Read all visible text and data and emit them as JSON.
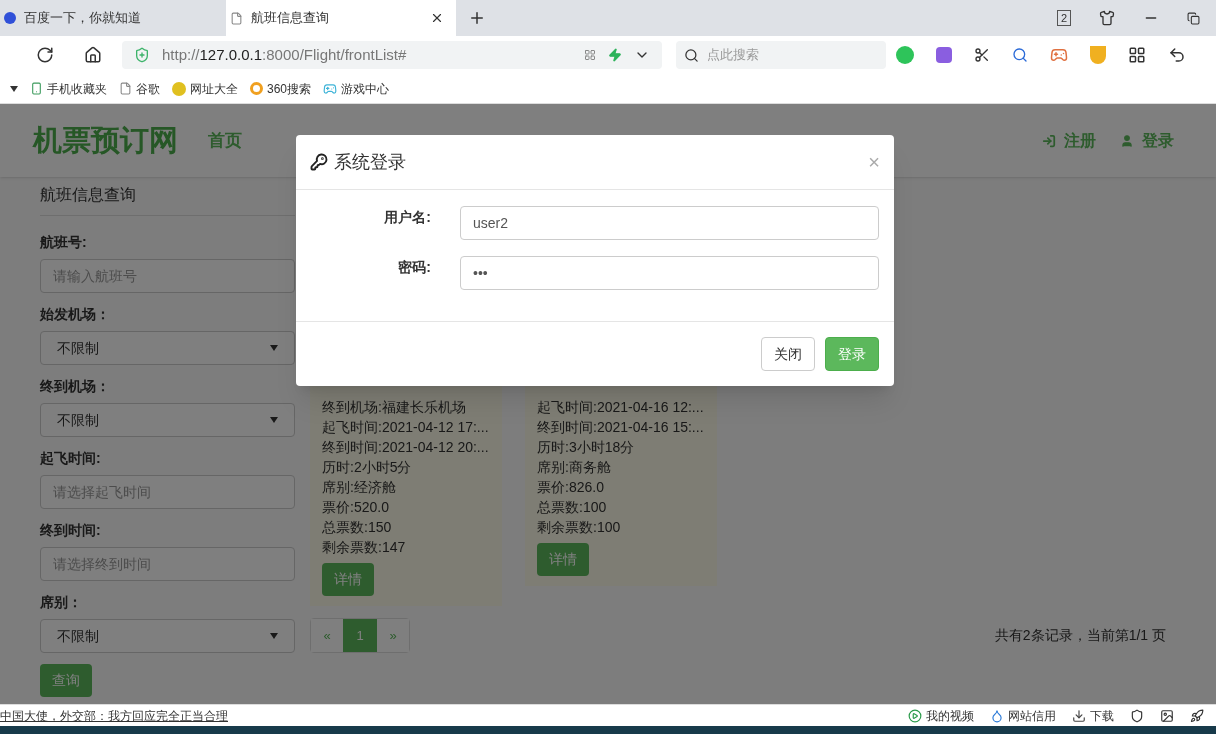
{
  "browser": {
    "tabs": [
      {
        "title": "百度一下，你就知道",
        "kind": "baidu",
        "selected": false
      },
      {
        "title": "航班信息查询",
        "kind": "page",
        "selected": true
      }
    ],
    "tab_count": "2",
    "address": {
      "scheme": "http://",
      "host": "127.0.0.1",
      "rest": ":8000/Flight/frontList#"
    },
    "search_placeholder": "点此搜索",
    "bookmarks": [
      {
        "label": "手机收藏夹",
        "kind": "phone"
      },
      {
        "label": "谷歌",
        "kind": "page"
      },
      {
        "label": "网址大全",
        "kind": "plus"
      },
      {
        "label": "360搜索",
        "kind": "ring"
      },
      {
        "label": "游戏中心",
        "kind": "game"
      }
    ]
  },
  "site": {
    "logo": "机票预订网",
    "nav": [
      {
        "label": "首页"
      }
    ],
    "auth": [
      {
        "label": "注册",
        "kind": "register"
      },
      {
        "label": "登录",
        "kind": "login"
      }
    ]
  },
  "filter": {
    "title": "航班信息查询",
    "fields": [
      {
        "label": "航班号:",
        "kind": "text",
        "placeholder": "请输入航班号"
      },
      {
        "label": "始发机场：",
        "kind": "select",
        "value": "不限制"
      },
      {
        "label": "终到机场：",
        "kind": "select",
        "value": "不限制"
      },
      {
        "label": "起飞时间:",
        "kind": "text",
        "placeholder": "请选择起飞时间"
      },
      {
        "label": "终到时间:",
        "kind": "text",
        "placeholder": "请选择终到时间"
      },
      {
        "label": "席别：",
        "kind": "select",
        "value": "不限制"
      }
    ],
    "button": "查询"
  },
  "flights": [
    {
      "lines": [
        "终到机场:福建长乐机场",
        "起飞时间:2021-04-12 17:...",
        "终到时间:2021-04-12 20:...",
        "历时:2小时5分",
        "席别:经济舱",
        "票价:520.0",
        "总票数:150",
        "剩余票数:147"
      ],
      "button": "详情"
    },
    {
      "lines": [
        "起飞时间:2021-04-16 12:...",
        "终到时间:2021-04-16 15:...",
        "历时:3小时18分",
        "席别:商务舱",
        "票价:826.0",
        "总票数:100",
        "剩余票数:100"
      ],
      "button": "详情"
    }
  ],
  "pagination": {
    "prev": "«",
    "pages": [
      {
        "label": "1",
        "selected": true
      }
    ],
    "next": "»"
  },
  "summary": "共有2条记录，当前第1/1 页",
  "modal": {
    "title": "系统登录",
    "close": "×",
    "fields": [
      {
        "label": "用户名:",
        "value": "user2"
      },
      {
        "label": "密码:",
        "value": "•••"
      }
    ],
    "buttons": [
      {
        "label": "关闭",
        "kind": "default"
      },
      {
        "label": "登录",
        "kind": "primary"
      }
    ]
  },
  "status_bar": {
    "news": "中国大使，外交部：我方回应完全正当合理",
    "items": [
      {
        "label": "我的视频",
        "kind": "video"
      },
      {
        "label": "网站信用",
        "kind": "drop"
      },
      {
        "label": "下载",
        "kind": "download"
      }
    ]
  }
}
